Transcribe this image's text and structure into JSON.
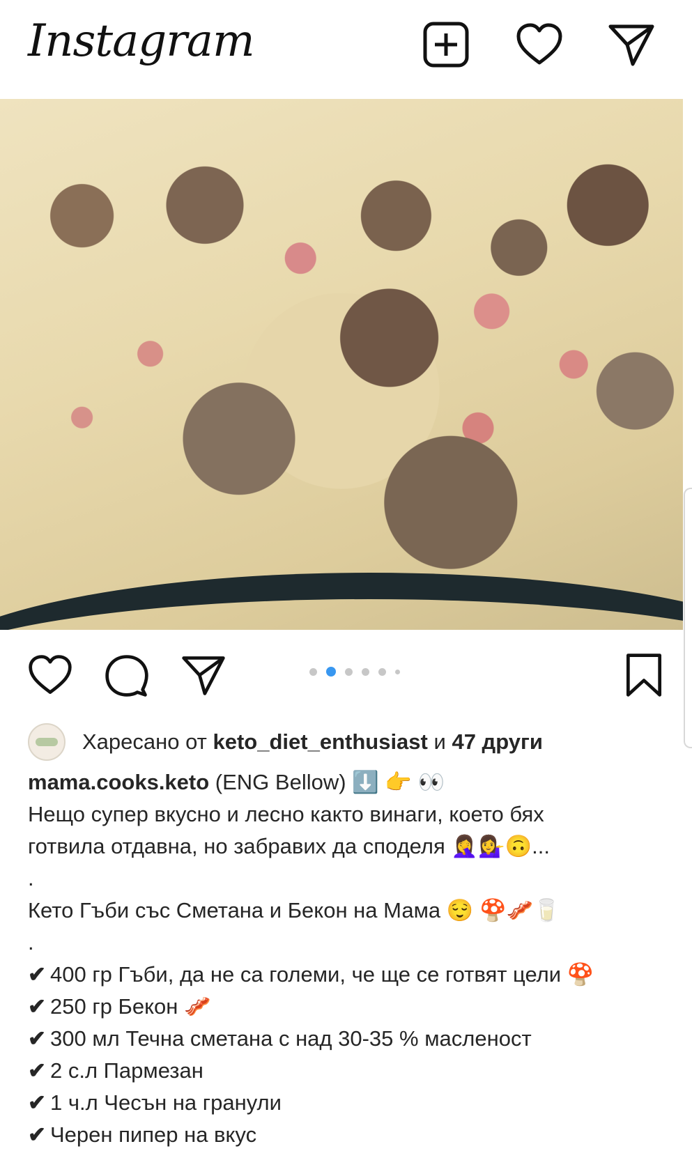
{
  "header": {
    "logo": "Instagram",
    "icons": [
      "new-post-icon",
      "heart-icon",
      "direct-message-icon"
    ]
  },
  "post": {
    "carousel": {
      "total_dots": 6,
      "active_index": 1
    },
    "likes": {
      "prefix": "Харесано от",
      "user": "keto_diet_enthusiast",
      "conj": "и",
      "others": "47 други"
    },
    "caption": {
      "username": "mama.cooks.keto",
      "first_line_rest": "(ENG Bellow) ⬇️ 👉 👀",
      "intro_1": "Нещо супер вкусно и лесно както винаги, което бях",
      "intro_2": "готвила отдавна, но забравих да споделя 🤦‍♀️💁‍♀️🙃...",
      "dot_1": ".",
      "title": "Кето Гъби със Сметана и Бекон на Мама 😌 🍄🥓🥛",
      "dot_2": ".",
      "check_mark": "✔",
      "ingredients": [
        "400 гр Гъби, да не са големи, че ще се готвят цели 🍄",
        "250 гр Бекон 🥓",
        "300 мл Течна сметана с над 30-35 % масленост",
        "2 с.л Пармезан",
        "1 ч.л Чесън на гранули",
        "Черен пипер на вкус"
      ]
    }
  }
}
